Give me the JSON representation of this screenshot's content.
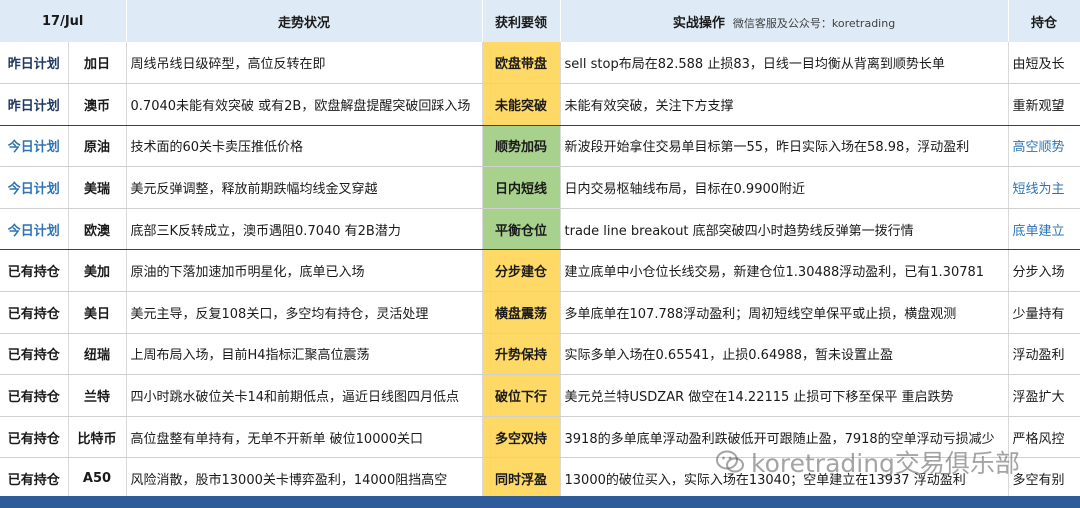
{
  "header": {
    "date": "17/Jul",
    "trend": "走势状况",
    "key": "获利要领",
    "action": "实战操作",
    "action_hint": "微信客服及公众号：koretrading",
    "position": "持仓"
  },
  "rows": [
    {
      "type": "昨日计划",
      "symbol": "加日",
      "trend": "周线吊线日级碎型，高位反转在即",
      "key": "欧盘带盘",
      "action": "sell stop布局在82.588 止损83，日线一目均衡从背离到顺势长单",
      "position": "由短及长"
    },
    {
      "type": "昨日计划",
      "symbol": "澳币",
      "trend": "0.7040未能有效突破 或有2B，欧盘解盘提醒突破回踩入场",
      "key": "未能突破",
      "action": "未能有效突破，关注下方支撑",
      "position": "重新观望"
    },
    {
      "type": "今日计划",
      "symbol": "原油",
      "trend": "技术面的60关卡卖压推低价格",
      "key": "顺势加码",
      "action": "新波段开始拿住交易单目标第一55，昨日实际入场在58.98，浮动盈利",
      "position": "高空顺势"
    },
    {
      "type": "今日计划",
      "symbol": "美瑞",
      "trend": "美元反弹调整，释放前期跌幅均线金叉穿越",
      "key": "日内短线",
      "action": "日内交易枢轴线布局，目标在0.9900附近",
      "position": "短线为主"
    },
    {
      "type": "今日计划",
      "symbol": "欧澳",
      "trend": "底部三K反转成立，澳币遇阻0.7040 有2B潜力",
      "key": "平衡仓位",
      "action": "trade line breakout  底部突破四小时趋势线反弹第一拨行情",
      "position": "底单建立"
    },
    {
      "type": "已有持仓",
      "symbol": "美加",
      "trend": "原油的下落加速加币明星化，底单已入场",
      "key": "分步建仓",
      "action": "建立底单中小仓位长线交易，新建仓位1.30488浮动盈利，已有1.30781",
      "position": "分步入场"
    },
    {
      "type": "已有持仓",
      "symbol": "美日",
      "trend": "美元主导，反复108关口，多空均有持仓，灵活处理",
      "key": "横盘震荡",
      "action": "多单底单在107.788浮动盈利；周初短线空单保平或止损，横盘观测",
      "position": "少量持有"
    },
    {
      "type": "已有持仓",
      "symbol": "纽瑞",
      "trend": "上周布局入场，目前H4指标汇聚高位震荡",
      "key": "升势保持",
      "action": "实际多单入场在0.65541，止损0.64988，暂未设置止盈",
      "position": "浮动盈利"
    },
    {
      "type": "已有持仓",
      "symbol": "兰特",
      "trend": "四小时跳水破位关卡14和前期低点，逼近日线图四月低点",
      "key": "破位下行",
      "action": "美元兑兰特USDZAR 做空在14.22115  止损可下移至保平 重启跌势",
      "position": "浮盈扩大"
    },
    {
      "type": "已有持仓",
      "symbol": "比特币",
      "trend": "高位盘整有单持有，无单不开新单 破位10000关口",
      "key": "多空双持",
      "action": "3918的多单底单浮动盈利跌破低开可跟随止盈，7918的空单浮动亏损减少",
      "position": "严格风控"
    },
    {
      "type": "已有持仓",
      "symbol": "A50",
      "trend": "风险消散，股市13000关卡博弈盈利，14000阻挡高空",
      "key": "同时浮盈",
      "action": "13000的破位买入，实际入场在13040；空单建立在13937 浮动盈利",
      "position": "多空有别"
    }
  ],
  "watermark": "koretrading交易俱乐部",
  "colors": {
    "header_bg": "#deebf7",
    "key_yellow": "#ffd966",
    "key_green": "#a9d18e",
    "today_blue": "#2e74b5",
    "bottom_bar": "#2e5c9a"
  }
}
